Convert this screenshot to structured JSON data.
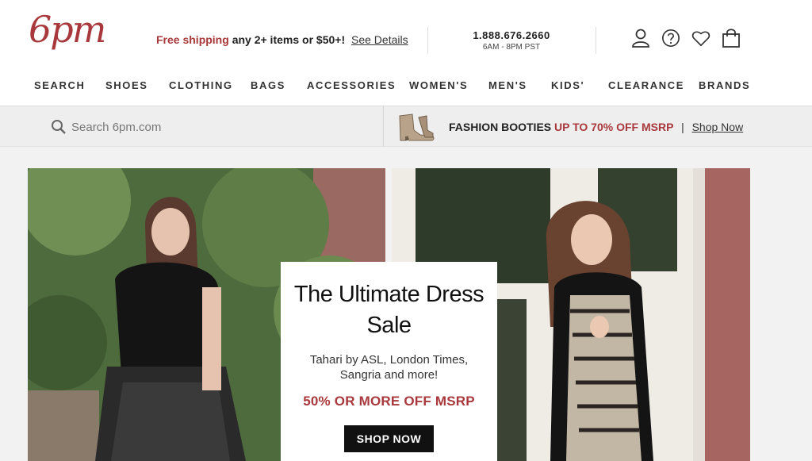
{
  "brand": {
    "logo_text": "6pm"
  },
  "promo": {
    "highlight": "Free shipping",
    "rest": "any 2+ items or $50+!",
    "link": "See Details"
  },
  "contact": {
    "phone": "1.888.676.2660",
    "hours": "6AM - 8PM PST"
  },
  "header_icons": [
    "account-icon",
    "help-icon",
    "favorites-heart-icon",
    "shopping-bag-icon"
  ],
  "nav": {
    "items": [
      "SEARCH",
      "SHOES",
      "CLOTHING",
      "BAGS",
      "ACCESSORIES",
      "WOMEN'S",
      "MEN'S",
      "KIDS'",
      "CLEARANCE",
      "BRANDS"
    ]
  },
  "search": {
    "placeholder": "Search 6pm.com"
  },
  "booties": {
    "label": "FASHION BOOTIES",
    "offer": "UP TO 70% OFF MSRP",
    "separator": "|",
    "link": "Shop Now"
  },
  "hero": {
    "title_line1": "The Ultimate Dress",
    "title_line2": "Sale",
    "brands": "Tahari by ASL, London Times, Sangria and more!",
    "discount": "50% OR MORE OFF MSRP",
    "cta": "SHOP NOW"
  },
  "colors": {
    "accent": "#a8383b",
    "cta_bg": "#111111",
    "bar_bg": "#eeeeee"
  }
}
